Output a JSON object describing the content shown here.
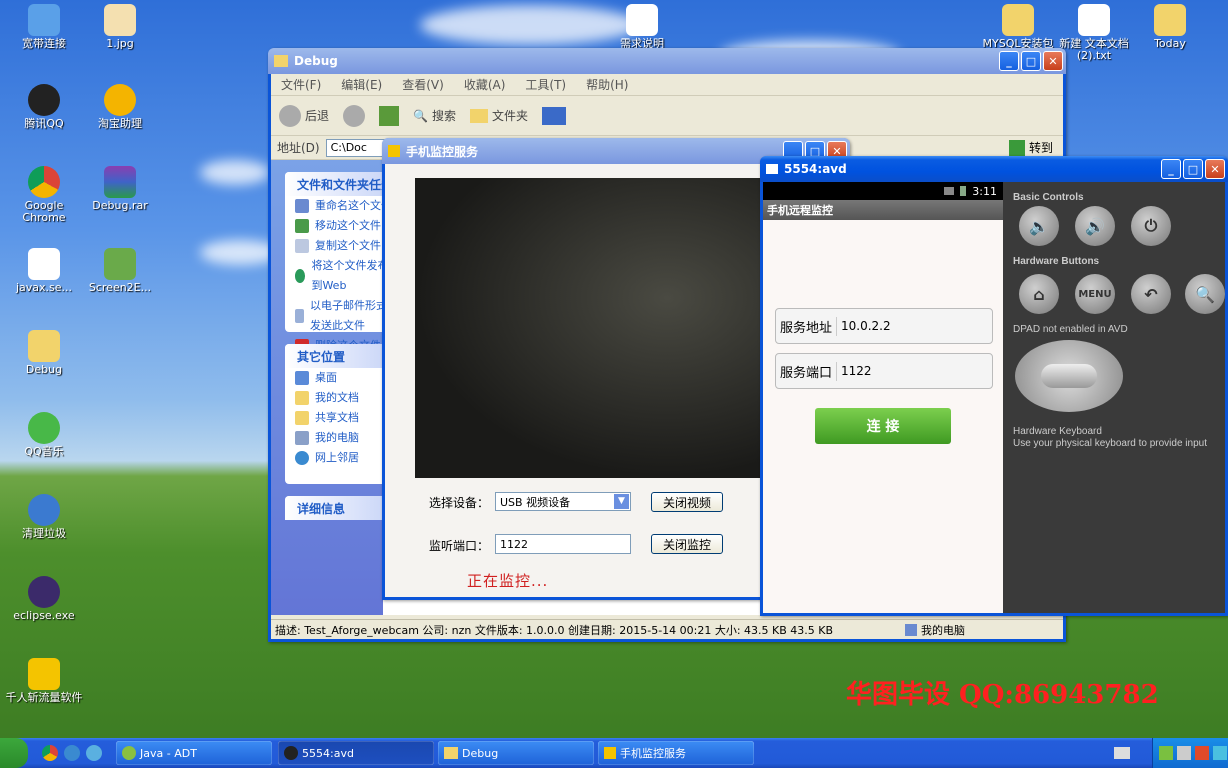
{
  "desktop": {
    "icons": [
      {
        "label": "宽带连接"
      },
      {
        "label": "1.jpg"
      },
      {
        "label": "腾讯QQ"
      },
      {
        "label": "淘宝助理"
      },
      {
        "label": "Google Chrome"
      },
      {
        "label": "Debug.rar"
      },
      {
        "label": "javax.se..."
      },
      {
        "label": "Screen2E..."
      },
      {
        "label": "Debug"
      },
      {
        "label": "QQ音乐"
      },
      {
        "label": "清理垃圾"
      },
      {
        "label": "eclipse.exe"
      },
      {
        "label": "千人斩流量软件"
      },
      {
        "label": "需求说明"
      },
      {
        "label": "MYSQL安装包"
      },
      {
        "label": "新建 文本文档 (2).txt"
      },
      {
        "label": "Today"
      }
    ],
    "watermark": "华图毕设 QQ:86943782"
  },
  "explorer": {
    "title": "Debug",
    "menu": [
      "文件(F)",
      "编辑(E)",
      "查看(V)",
      "收藏(A)",
      "工具(T)",
      "帮助(H)"
    ],
    "toolbar": {
      "back": "后退",
      "search": "搜索",
      "folders": "文件夹"
    },
    "address_label": "地址(D)",
    "address_value": "C:\\Doc",
    "go": "转到",
    "tasks_title": "文件和文件夹任务",
    "tasks": [
      "重命名这个文件",
      "移动这个文件",
      "复制这个文件",
      "将这个文件发布到Web",
      "以电子邮件形式发送此文件",
      "删除这个文件"
    ],
    "places_title": "其它位置",
    "places": [
      "桌面",
      "我的文档",
      "共享文档",
      "我的电脑",
      "网上邻居"
    ],
    "details_title": "详细信息",
    "status": "描述: Test_Aforge_webcam 公司: nzn 文件版本: 1.0.0.0 创建日期: 2015-5-14 00:21 大小: 43.5 KB 43.5 KB",
    "status_right": "我的电脑"
  },
  "monitor": {
    "title": "手机监控服务",
    "device_label": "选择设备：",
    "device_value": "USB 视频设备",
    "close_video": "关闭视频",
    "port_label": "监听端口：",
    "port_value": "1122",
    "close_monitor": "关闭监控",
    "status": "正在监控..."
  },
  "avd": {
    "title": "5554:avd",
    "clock": "3:11",
    "app_title": "手机远程监控",
    "addr_label": "服务地址",
    "addr_value": "10.0.2.2",
    "port_label": "服务端口",
    "port_value": "1122",
    "connect": "连 接",
    "basic_controls": "Basic Controls",
    "hardware_buttons": "Hardware Buttons",
    "menu_btn": "MENU",
    "dpad": "DPAD not enabled in AVD",
    "hw_keyboard": "Hardware Keyboard",
    "hw_keyboard_note": "Use your physical keyboard to provide input"
  },
  "taskbar": {
    "items": [
      "Java - ADT",
      "5554:avd",
      "Debug",
      "手机监控服务"
    ]
  }
}
